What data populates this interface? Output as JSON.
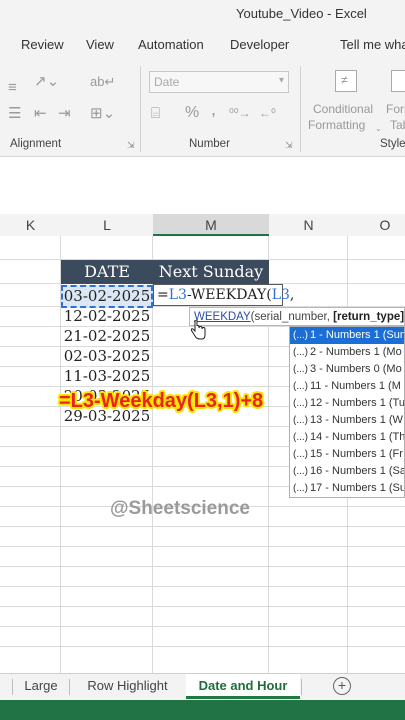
{
  "window": {
    "title": "Youtube_Video  -  Excel"
  },
  "menu": {
    "tabs": [
      "Review",
      "View",
      "Automation",
      "Developer"
    ],
    "tell_me": "Tell me wha"
  },
  "ribbon": {
    "groups": [
      "Alignment",
      "Number",
      "Style"
    ],
    "number_format": "Date",
    "conditional_formatting": [
      "Conditional",
      "Formatting"
    ],
    "format_partial": [
      "Form",
      "Tab"
    ],
    "percent": "%",
    "comma": ",",
    "dollar_partial": "$"
  },
  "columns": [
    "K",
    "L",
    "M",
    "N",
    "O"
  ],
  "table": {
    "headers": [
      "DATE",
      "Next Sunday"
    ],
    "dates": [
      "03-02-2025",
      "12-02-2025",
      "21-02-2025",
      "02-03-2025",
      "11-03-2025",
      "20-03-2025",
      "29-03-2025"
    ]
  },
  "formula_cell": {
    "prefix": "=",
    "ref1": "L3",
    "middle": "-WEEKDAY(",
    "ref2": "L3",
    "suffix": ","
  },
  "tooltip": {
    "fn": "WEEKDAY",
    "args": "(serial_number, ",
    "bold_arg": "[return_type]",
    "close": ")"
  },
  "autocomplete": {
    "items": [
      "1 - Numbers 1 (Sun",
      "2 - Numbers 1 (Mo",
      "3 - Numbers 0 (Mo",
      "11 - Numbers 1 (M",
      "12 - Numbers 1 (Tu",
      "13 - Numbers 1 (W",
      "14 - Numbers 1 (Th",
      "15 - Numbers 1 (Fr",
      "16 - Numbers 1 (Sa",
      "17 - Numbers 1 (Su"
    ],
    "selected_index": 0,
    "icon_glyph": "(...)"
  },
  "overlay_formula": "=L3-Weekday(L3,1)+8",
  "watermark": "@Sheetscience",
  "sheet_tabs": [
    "Large",
    "Row Highlight",
    "Date and Hour"
  ],
  "active_sheet": "Date and Hour",
  "add_sheet_glyph": "+",
  "colors": {
    "header_fill": "#3b4a5c",
    "excel_green": "#217346",
    "selection_blue": "#1b6ed6",
    "overlay_red": "#e8231d",
    "overlay_yellow": "#ffe400"
  }
}
